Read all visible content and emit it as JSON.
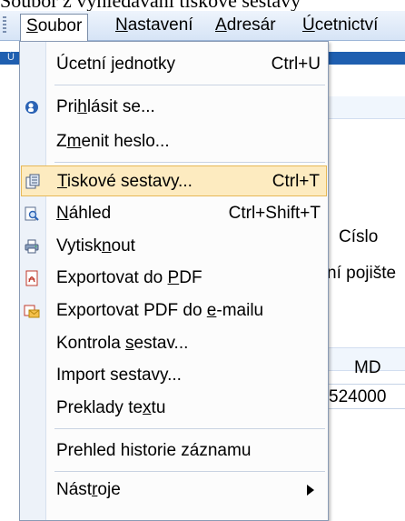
{
  "caption": "Soubor z vyhledávání tiskové sestavy",
  "menubar": {
    "items": [
      {
        "pre": "",
        "mn": "S",
        "post": "oubor"
      },
      {
        "pre": "",
        "mn": "N",
        "post": "astavení"
      },
      {
        "pre": "",
        "mn": "A",
        "post": "dresár"
      },
      {
        "pre": "",
        "mn": "Ú",
        "post": "cetnictví"
      }
    ]
  },
  "background": {
    "strip_label": "Ú",
    "cislo": "Císlo",
    "pojisteni": "ní pojište",
    "md": "MD",
    "cell_value": "524000"
  },
  "menu": {
    "items": [
      {
        "pre": "Úcetní jednotky",
        "mn": "",
        "post": "",
        "shortcut": "Ctrl+U",
        "icon": "none"
      },
      {
        "pre": "Pri",
        "mn": "h",
        "post": "lásit se...",
        "shortcut": "",
        "icon": "login-icon"
      },
      {
        "pre": "Z",
        "mn": "m",
        "post": "enit heslo...",
        "shortcut": "",
        "icon": "none"
      },
      {
        "pre": "",
        "mn": "T",
        "post": "iskové sestavy...",
        "shortcut": "Ctrl+T",
        "icon": "report-icon"
      },
      {
        "pre": "",
        "mn": "N",
        "post": "áhled",
        "shortcut": "Ctrl+Shift+T",
        "icon": "preview-icon"
      },
      {
        "pre": "Vytisk",
        "mn": "n",
        "post": "out",
        "shortcut": "",
        "icon": "printer-icon"
      },
      {
        "pre": "Exportovat do ",
        "mn": "P",
        "post": "DF",
        "shortcut": "",
        "icon": "pdf-icon"
      },
      {
        "pre": "Exportovat PDF do ",
        "mn": "e",
        "post": "-mailu",
        "shortcut": "",
        "icon": "pdf-email-icon"
      },
      {
        "pre": "Kontrola ",
        "mn": "s",
        "post": "estav...",
        "shortcut": "",
        "icon": "none"
      },
      {
        "pre": "Import sestavy...",
        "mn": "",
        "post": "",
        "shortcut": "",
        "icon": "none"
      },
      {
        "pre": "Preklady te",
        "mn": "x",
        "post": "tu",
        "shortcut": "",
        "icon": "none"
      },
      {
        "pre": "Prehled historie záznamu",
        "mn": "",
        "post": "",
        "shortcut": "",
        "icon": "none"
      },
      {
        "pre": "Nást",
        "mn": "r",
        "post": "oje",
        "shortcut": "",
        "icon": "none"
      }
    ],
    "highlighted_index": 3,
    "colors": {
      "highlight_bg": "#fdebc0",
      "highlight_border": "#e6b857",
      "menubar_bg": "#dce8f7"
    }
  }
}
